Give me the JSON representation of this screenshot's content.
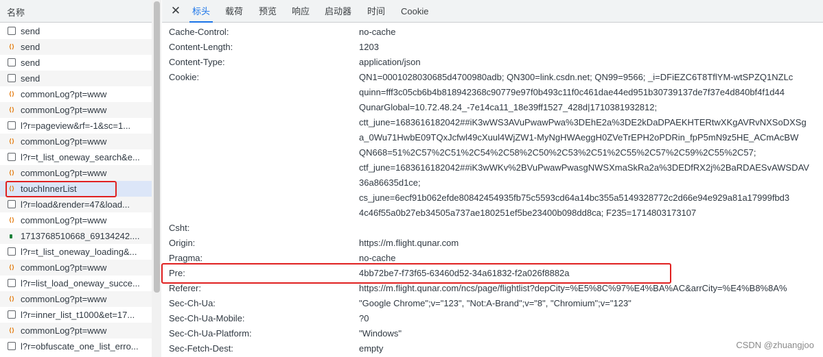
{
  "left_panel": {
    "header": "名称",
    "requests": [
      {
        "name": "send",
        "icon": "doc-icon"
      },
      {
        "name": "send",
        "icon": "xhr-icon"
      },
      {
        "name": "send",
        "icon": "doc-icon"
      },
      {
        "name": "send",
        "icon": "doc-icon"
      },
      {
        "name": "commonLog?pt=www",
        "icon": "xhr-icon"
      },
      {
        "name": "commonLog?pt=www",
        "icon": "xhr-icon"
      },
      {
        "name": "l?r=pageview&rf=-1&sc=1...",
        "icon": "doc-icon"
      },
      {
        "name": "commonLog?pt=www",
        "icon": "xhr-icon"
      },
      {
        "name": "l?r=t_list_oneway_search&e...",
        "icon": "doc-icon"
      },
      {
        "name": "commonLog?pt=www",
        "icon": "xhr-icon"
      },
      {
        "name": "touchInnerList",
        "icon": "xhr-icon",
        "selected": true
      },
      {
        "name": "l?r=load&render=47&load...",
        "icon": "doc-icon"
      },
      {
        "name": "commonLog?pt=www",
        "icon": "xhr-icon"
      },
      {
        "name": "1713768510668_69134242....",
        "icon": "image-icon"
      },
      {
        "name": "l?r=t_list_oneway_loading&...",
        "icon": "doc-icon"
      },
      {
        "name": "commonLog?pt=www",
        "icon": "xhr-icon"
      },
      {
        "name": "l?r=list_load_oneway_succe...",
        "icon": "doc-icon"
      },
      {
        "name": "commonLog?pt=www",
        "icon": "xhr-icon"
      },
      {
        "name": "l?r=inner_list_t1000&et=17...",
        "icon": "doc-icon"
      },
      {
        "name": "commonLog?pt=www",
        "icon": "xhr-icon"
      },
      {
        "name": "l?r=obfuscate_one_list_erro...",
        "icon": "doc-icon"
      }
    ]
  },
  "detail_panel": {
    "close_label": "✕",
    "tabs": [
      "标头",
      "载荷",
      "预览",
      "响应",
      "启动器",
      "时间",
      "Cookie"
    ],
    "active_tab": "标头",
    "headers": [
      {
        "key": "Cache-Control:",
        "lines": [
          "no-cache"
        ]
      },
      {
        "key": "Content-Length:",
        "lines": [
          "1203"
        ]
      },
      {
        "key": "Content-Type:",
        "lines": [
          "application/json"
        ]
      },
      {
        "key": "Cookie:",
        "lines": [
          "QN1=0001028030685d4700980adb; QN300=link.csdn.net; QN99=9566; _i=DFiEZC6T8TflYM-wtSPZQ1NZLc",
          "quinn=fff3c05cb6b4b818942368c90779e97f0b493c11f0c461dae44ed951b30739137de7f37e4d840bf4f1d44",
          "QunarGlobal=10.72.48.24_-7e14ca11_18e39ff1527_428d|1710381932812;",
          "ctt_june=1683616182042##iK3wWS3AVuPwawPwa%3DEhE2a%3DE2kDaDPAEKHTERtwXKgAVRvNXSoDXSg",
          "a_0Wu71HwbE09TQxJcfwl49cXuul4WjZW1-MyNgHWAeggH0ZVeTrEPH2oPDRin_fpP5mN9z5HE_ACmAcBW",
          "QN668=51%2C57%2C51%2C54%2C58%2C50%2C53%2C51%2C55%2C57%2C59%2C55%2C57;",
          "ctf_june=1683616182042##iK3wWKv%2BVuPwawPwasgNWSXmaSkRa2a%3DEDfRX2j%2BaRDAESvAWSDAV",
          "36a86635d1ce;",
          "cs_june=6ecf91b062efde80842454935fb75c5593cd64a14bc355a5149328772c2d66e94e929a81a17999fbd3",
          "4c46f55a0b27eb34505a737ae180251ef5be23400b098dd8ca; F235=1714803173107"
        ]
      },
      {
        "key": "Csht:",
        "lines": [
          ""
        ]
      },
      {
        "key": "Origin:",
        "lines": [
          "https://m.flight.qunar.com"
        ]
      },
      {
        "key": "Pragma:",
        "lines": [
          "no-cache"
        ]
      },
      {
        "key": "Pre:",
        "lines": [
          "4bb72be7-f73f65-63460d52-34a61832-f2a026f8882a"
        ]
      },
      {
        "key": "Referer:",
        "lines": [
          "https://m.flight.qunar.com/ncs/page/flightlist?depCity=%E5%8C%97%E4%BA%AC&arrCity=%E4%B8%8A%"
        ]
      },
      {
        "key": "Sec-Ch-Ua:",
        "lines": [
          "\"Google Chrome\";v=\"123\", \"Not:A-Brand\";v=\"8\", \"Chromium\";v=\"123\""
        ]
      },
      {
        "key": "Sec-Ch-Ua-Mobile:",
        "lines": [
          "?0"
        ]
      },
      {
        "key": "Sec-Ch-Ua-Platform:",
        "lines": [
          "\"Windows\""
        ]
      },
      {
        "key": "Sec-Fetch-Dest:",
        "lines": [
          "empty"
        ]
      }
    ]
  },
  "watermark": "CSDN @zhuangjoo",
  "colors": {
    "accent": "#1a73e8",
    "highlight_box": "#e02020",
    "selected_row": "#dce6f8"
  }
}
